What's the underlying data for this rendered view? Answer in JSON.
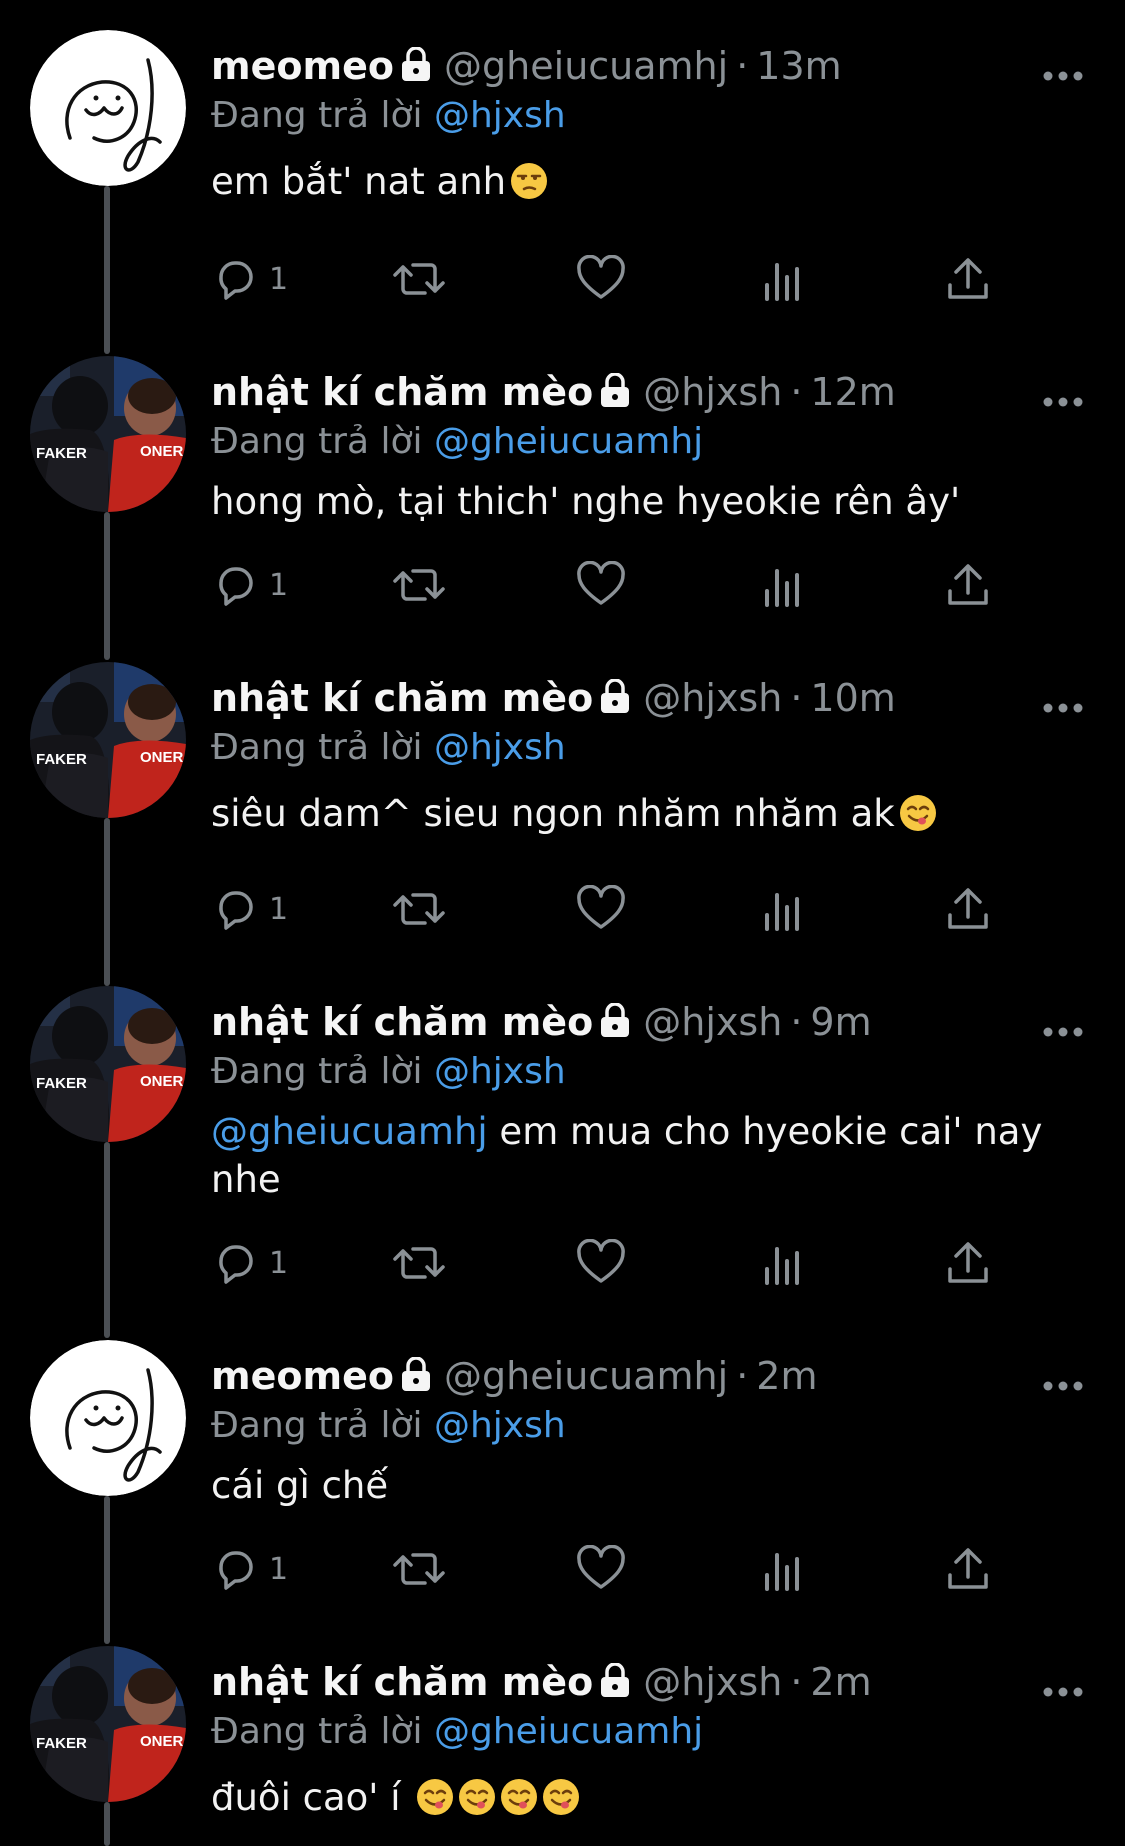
{
  "reply_prefix": "Đang trả lời",
  "icons": {
    "lock": "lock-icon",
    "more": "more-dots-icon",
    "reply": "reply-icon",
    "retweet": "retweet-icon",
    "like": "heart-icon",
    "views": "views-icon",
    "share": "share-icon"
  },
  "colors": {
    "background": "#000000",
    "mention": "#4a9de8",
    "muted": "#8b9196",
    "thread_line": "#4b4f54"
  },
  "tweets": [
    {
      "name": "meomeo",
      "handle": "@gheiucuamhj",
      "sep": "·",
      "time": "13m",
      "reply_to": "@hjxsh",
      "text_mention": "",
      "text": "em bắt' nat anh",
      "emoji": "unamused",
      "reply_count": "1",
      "avatar": "doodle"
    },
    {
      "name": "nhật kí chăm mèo",
      "handle": "@hjxsh",
      "sep": "·",
      "time": "12m",
      "reply_to": "@gheiucuamhj",
      "text_mention": "",
      "text": "hong mò, tại thich' nghe hyeokie rên ây'",
      "emoji": "",
      "reply_count": "1",
      "avatar": "photo"
    },
    {
      "name": "nhật kí chăm mèo",
      "handle": "@hjxsh",
      "sep": "·",
      "time": "10m",
      "reply_to": "@hjxsh",
      "text_mention": "",
      "text": "siêu dam^ sieu ngon nhăm nhăm ak",
      "emoji": "yum",
      "reply_count": "1",
      "avatar": "photo"
    },
    {
      "name": "nhật kí chăm mèo",
      "handle": "@hjxsh",
      "sep": "·",
      "time": "9m",
      "reply_to": "@hjxsh",
      "text_mention": "@gheiucuamhj",
      "text": " em mua cho hyeokie cai' nay nhe",
      "emoji": "",
      "reply_count": "1",
      "avatar": "photo"
    },
    {
      "name": "meomeo",
      "handle": "@gheiucuamhj",
      "sep": "·",
      "time": "2m",
      "reply_to": "@hjxsh",
      "text_mention": "",
      "text": "cái gì chế",
      "emoji": "",
      "reply_count": "1",
      "avatar": "doodle"
    },
    {
      "name": "nhật kí chăm mèo",
      "handle": "@hjxsh",
      "sep": "·",
      "time": "2m",
      "reply_to": "@gheiucuamhj",
      "text_mention": "",
      "text": "đuôi cao' í",
      "emoji": "yum-x4",
      "reply_count": "",
      "avatar": "photo"
    }
  ],
  "avatar_jersey_labels": [
    "FAKER",
    "ONER"
  ]
}
